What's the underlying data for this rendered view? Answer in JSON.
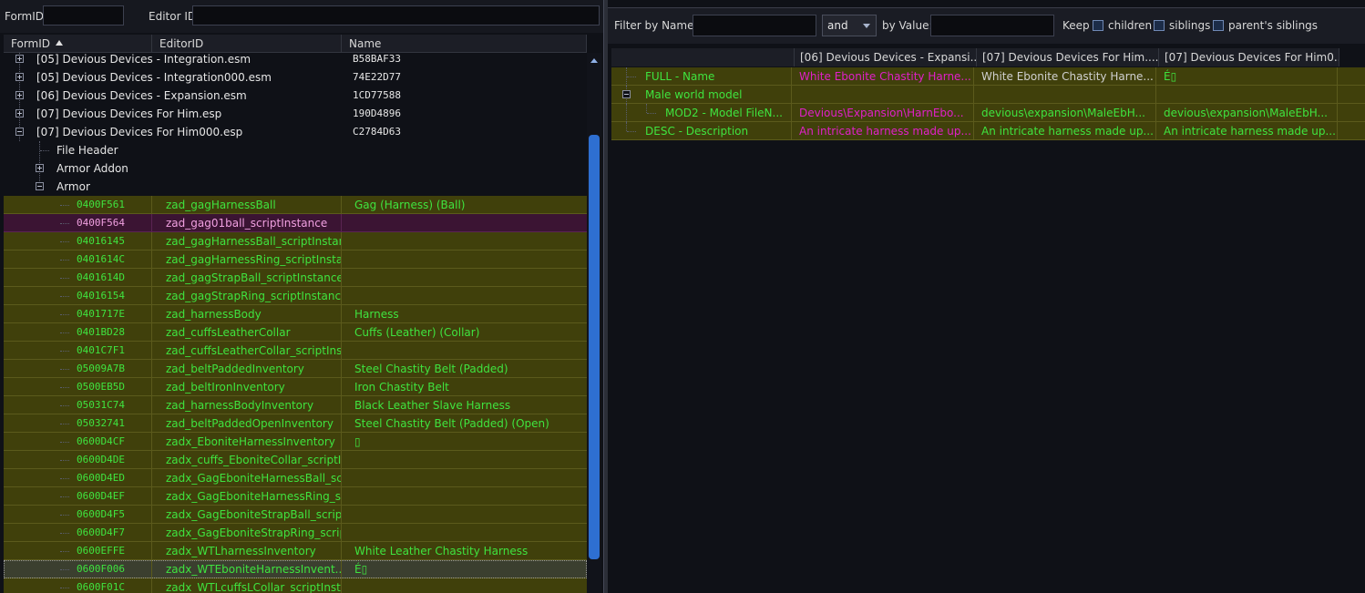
{
  "left_filter": {
    "formid_label": "FormID",
    "formid_value": "",
    "editorid_label": "Editor ID",
    "editorid_value": ""
  },
  "columns": {
    "formid": "FormID",
    "editorid": "EditorID",
    "name": "Name"
  },
  "plugins": [
    {
      "label": "[05] Devious Devices - Integration.esm",
      "hash": "B58BAF33"
    },
    {
      "label": "[05] Devious Devices - Integration000.esm",
      "hash": "74E22D77"
    },
    {
      "label": "[06] Devious Devices - Expansion.esm",
      "hash": "1CD77588"
    },
    {
      "label": "[07] Devious Devices For Him.esp",
      "hash": "190D4896"
    },
    {
      "label": "[07] Devious Devices For Him000.esp",
      "hash": "C2784D63"
    }
  ],
  "groups": {
    "file_header": "File Header",
    "armor_addon": "Armor Addon",
    "armor": "Armor"
  },
  "records": [
    {
      "formid": "0400F561",
      "editorid": "zad_gagHarnessBall",
      "name": "Gag (Harness) (Ball)"
    },
    {
      "formid": "0400F564",
      "editorid": "zad_gag01ball_scriptInstance",
      "name": ""
    },
    {
      "formid": "04016145",
      "editorid": "zad_gagHarnessBall_scriptInstance",
      "name": ""
    },
    {
      "formid": "0401614C",
      "editorid": "zad_gagHarnessRing_scriptInstance",
      "name": ""
    },
    {
      "formid": "0401614D",
      "editorid": "zad_gagStrapBall_scriptInstance",
      "name": ""
    },
    {
      "formid": "04016154",
      "editorid": "zad_gagStrapRing_scriptInstance",
      "name": ""
    },
    {
      "formid": "0401717E",
      "editorid": "zad_harnessBody",
      "name": "Harness"
    },
    {
      "formid": "0401BD28",
      "editorid": "zad_cuffsLeatherCollar",
      "name": "Cuffs (Leather) (Collar)"
    },
    {
      "formid": "0401C7F1",
      "editorid": "zad_cuffsLeatherCollar_scriptInstance",
      "name": ""
    },
    {
      "formid": "05009A7B",
      "editorid": "zad_beltPaddedInventory",
      "name": "Steel Chastity Belt (Padded)"
    },
    {
      "formid": "0500EB5D",
      "editorid": "zad_beltIronInventory",
      "name": "Iron Chastity Belt"
    },
    {
      "formid": "05031C74",
      "editorid": "zad_harnessBodyInventory",
      "name": "Black Leather Slave Harness"
    },
    {
      "formid": "05032741",
      "editorid": "zad_beltPaddedOpenInventory",
      "name": "Steel Chastity Belt (Padded) (Open)"
    },
    {
      "formid": "0600D4CF",
      "editorid": "zadx_EboniteHarnessInventory",
      "name": "▯"
    },
    {
      "formid": "0600D4DE",
      "editorid": "zadx_cuffs_EboniteCollar_scriptInstance",
      "name": ""
    },
    {
      "formid": "0600D4ED",
      "editorid": "zadx_GagEboniteHarnessBall_scriptInstance",
      "name": ""
    },
    {
      "formid": "0600D4EF",
      "editorid": "zadx_GagEboniteHarnessRing_scriptInstance",
      "name": ""
    },
    {
      "formid": "0600D4F5",
      "editorid": "zadx_GagEboniteStrapBall_scriptInstance",
      "name": ""
    },
    {
      "formid": "0600D4F7",
      "editorid": "zadx_GagEboniteStrapRing_scriptInstance",
      "name": ""
    },
    {
      "formid": "0600EFFE",
      "editorid": "zadx_WTLharnessInventory",
      "name": "White Leather Chastity Harness"
    },
    {
      "formid": "0600F006",
      "editorid": "zadx_WTEboniteHarnessInvent...",
      "name": "É▯"
    },
    {
      "formid": "0600F01C",
      "editorid": "zadx_WTLcuffsLCollar_scriptInstance",
      "name": ""
    }
  ],
  "right_filter": {
    "filter_name_label": "Filter by Name:",
    "name_value": "",
    "operator": "and",
    "by_value_label": "by Value:",
    "value_value": "",
    "keep_label": "Keep",
    "children_label": "children",
    "siblings_label": "siblings",
    "parents_siblings_label": "parent's siblings"
  },
  "compare_columns": [
    "[06] Devious Devices - Expansi...",
    "[07] Devious Devices For Him....",
    "[07] Devious Devices For Him0..."
  ],
  "compare_rows": [
    {
      "label": "FULL - Name",
      "v1": "White Ebonite Chastity Harne...",
      "v2": "White Ebonite Chastity Harne...",
      "v3": "É▯"
    },
    {
      "label": "Male world model",
      "v1": "",
      "v2": "",
      "v3": ""
    },
    {
      "label": "MOD2 - Model FileN...",
      "v1": "Devious\\Expansion\\HarnEbo...",
      "v2": "devious\\expansion\\MaleEbH...",
      "v3": "devious\\expansion\\MaleEbH..."
    },
    {
      "label": "DESC - Description",
      "v1": "An intricate harness made up...",
      "v2": "An intricate harness made up...",
      "v3": "An intricate harness made up..."
    }
  ]
}
